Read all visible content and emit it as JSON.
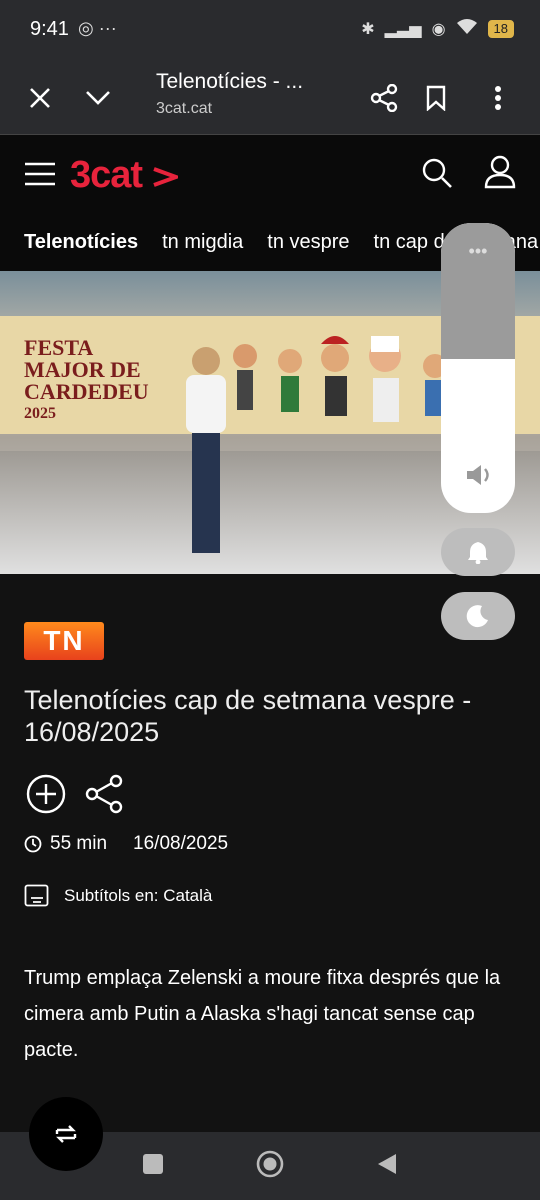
{
  "status_bar": {
    "time": "9:41",
    "left_icons": "◎ ···",
    "battery": "18"
  },
  "browser": {
    "title": "Telenotícies - ...",
    "url": "3cat.cat"
  },
  "site": {
    "logo": "3cat",
    "nav_tabs": [
      "Telenotícies",
      "tn migdia",
      "tn vespre",
      "tn cap de setmana"
    ]
  },
  "video": {
    "banner_text": [
      "FESTA",
      "MAJOR DE",
      "CARDEDEU",
      "2025"
    ]
  },
  "program": {
    "badge": "TN",
    "title": "Telenotícies cap de setmana vespre - 16/08/2025",
    "duration": "55 min",
    "date": "16/08/2025",
    "subtitles": "Subtítols en: Català",
    "description": "Trump emplaça Zelenski a moure fitxa després que la cimera amb Putin a Alaska s'hagi tancat sense cap pacte."
  },
  "volume_panel": {
    "level_percent": 53
  }
}
